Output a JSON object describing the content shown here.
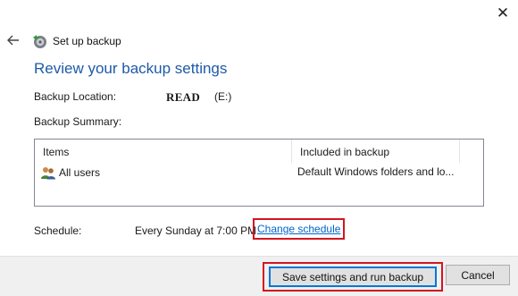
{
  "window": {
    "title": "Set up backup",
    "close_glyph": "✕",
    "icons": {
      "back": "back-arrow-icon",
      "app": "backup-app-icon",
      "close": "close-icon"
    }
  },
  "page": {
    "heading": "Review your backup settings",
    "backup_location_label": "Backup Location:",
    "backup_location_name": "READ",
    "backup_location_drive": "(E:)",
    "backup_summary_label": "Backup Summary:"
  },
  "summary_table": {
    "columns": [
      "Items",
      "Included in backup"
    ],
    "rows": [
      {
        "item": "All users",
        "included": "Default Windows folders and lo...",
        "icon": "users-icon"
      }
    ]
  },
  "schedule": {
    "label": "Schedule:",
    "value": "Every Sunday at 7:00 PM",
    "change_link": "Change schedule"
  },
  "footer": {
    "save_button": "Save settings and run backup",
    "cancel_button": "Cancel"
  },
  "colors": {
    "heading": "#1e5aa8",
    "link": "#0066cc",
    "highlight": "#d4151f",
    "footer_bg": "#f0f0f0"
  }
}
